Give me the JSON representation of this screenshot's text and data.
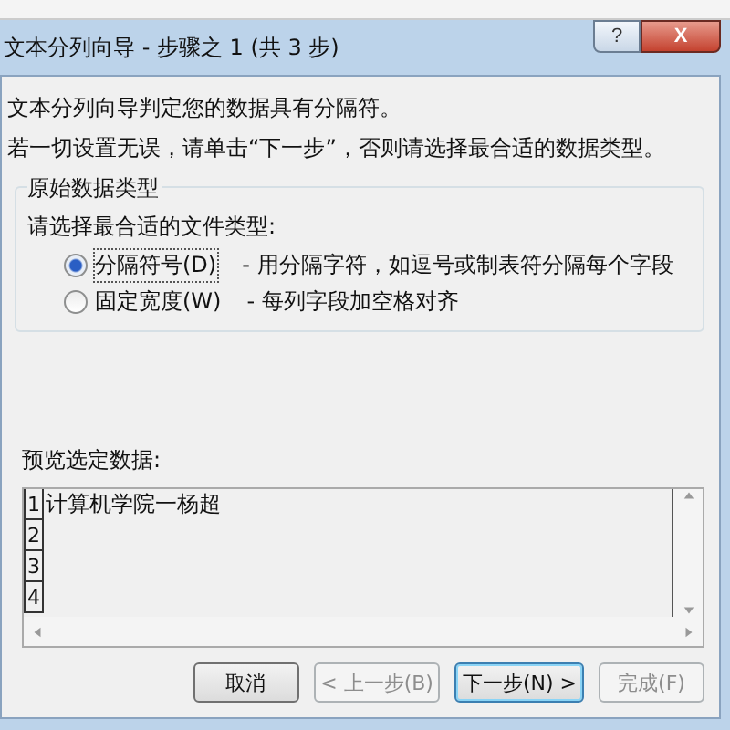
{
  "window": {
    "title": "文本分列向导 - 步骤之 1 (共 3 步)",
    "help": "?",
    "close": "X"
  },
  "intro": [
    "文本分列向导判定您的数据具有分隔符。",
    "若一切设置无误，请单击“下一步”，否则请选择最合适的数据类型。"
  ],
  "group": {
    "title": "原始数据类型",
    "prompt": "请选择最合适的文件类型:",
    "options": [
      {
        "label": "分隔符号(D)",
        "description": "- 用分隔字符，如逗号或制表符分隔每个字段",
        "selected": true
      },
      {
        "label": "固定宽度(W)",
        "description": "- 每列字段加空格对齐",
        "selected": false
      }
    ]
  },
  "preview": {
    "label": "预览选定数据:",
    "rows": [
      {
        "number": "1",
        "text": "计算机学院一杨超"
      },
      {
        "number": "2",
        "text": ""
      },
      {
        "number": "3",
        "text": ""
      },
      {
        "number": "4",
        "text": ""
      }
    ]
  },
  "buttons": [
    {
      "label": "取消",
      "disabled": false,
      "default": false
    },
    {
      "label": "< 上一步(B)",
      "disabled": true,
      "default": false
    },
    {
      "label": "下一步(N) >",
      "disabled": false,
      "default": true
    },
    {
      "label": "完成(F)",
      "disabled": true,
      "default": false
    }
  ]
}
